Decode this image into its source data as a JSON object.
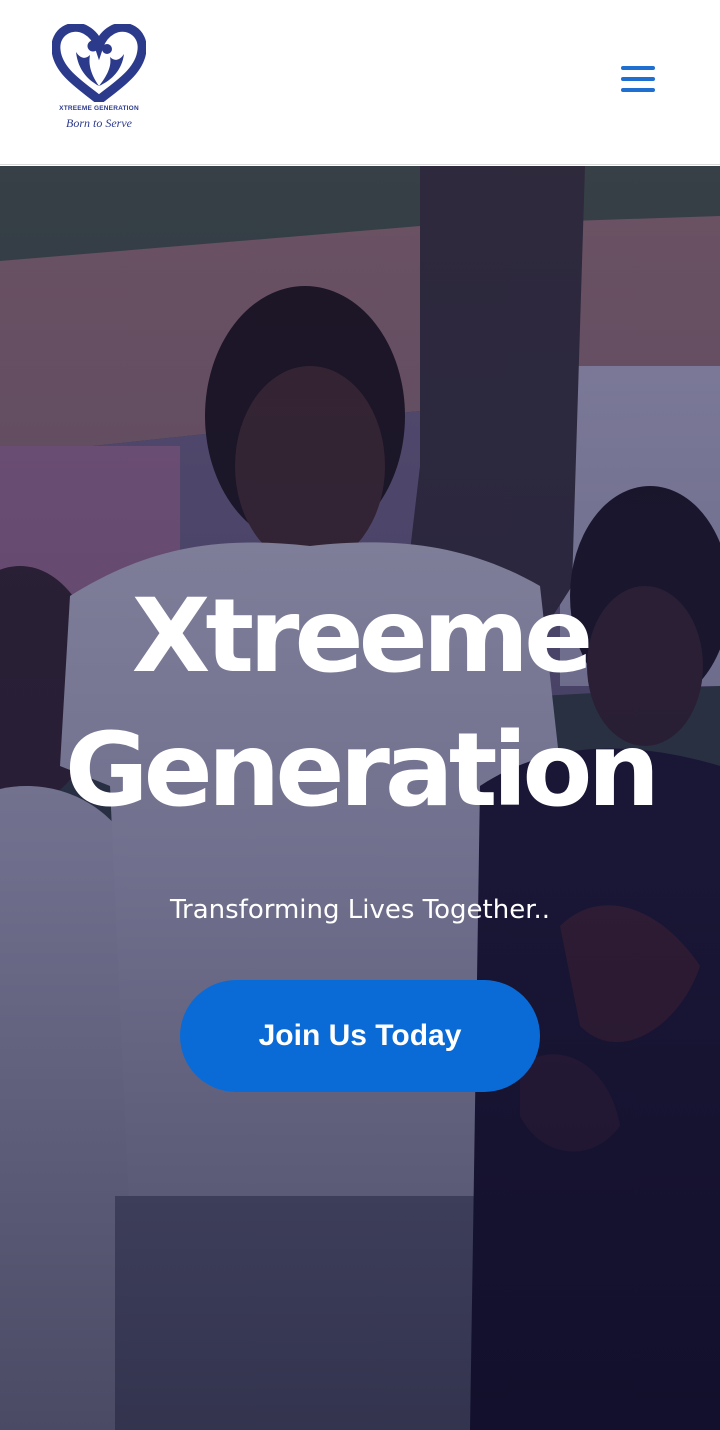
{
  "header": {
    "logo": {
      "name": "XTREEME GENERATION",
      "tagline": "Born to Serve",
      "icon": "heart-people-logo"
    },
    "menu_icon": "hamburger-menu-icon"
  },
  "hero": {
    "title_line1": "Xtreeme",
    "title_line2": "Generation",
    "subtitle": "Transforming Lives Together..",
    "cta_label": "Join Us Today"
  },
  "colors": {
    "brand_blue": "#2c3a8c",
    "menu_blue": "#1f6fd1",
    "cta_blue": "#0b6bd6",
    "overlay": "#181846"
  }
}
